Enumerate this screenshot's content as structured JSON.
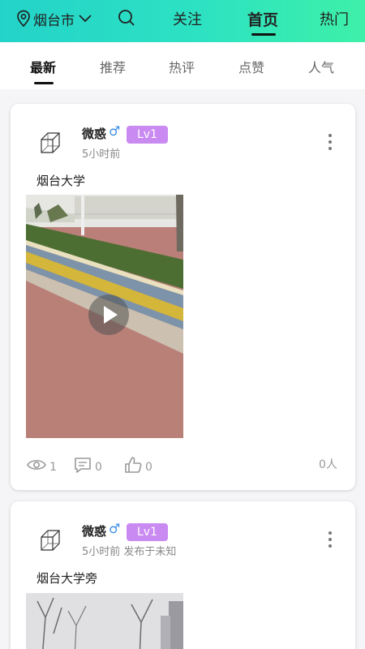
{
  "header": {
    "city": "烟台市",
    "tabs": [
      {
        "label": "关注"
      },
      {
        "label": "首页"
      },
      {
        "label": "热门"
      }
    ]
  },
  "subtabs": [
    "最新",
    "推荐",
    "热评",
    "点赞",
    "人气"
  ],
  "posts": [
    {
      "username": "微惑",
      "gender_symbol": "♂",
      "level": "Lv1",
      "time": "5小时前",
      "title": "烟台大学",
      "views": "1",
      "comments": "0",
      "likes": "0",
      "people": "0人"
    },
    {
      "username": "微惑",
      "gender_symbol": "♂",
      "level": "Lv1",
      "time": "5小时前 发布于未知",
      "title": "烟台大学旁"
    }
  ],
  "colors": {
    "header_gradient_start": "#23d3c9",
    "header_gradient_end": "#3ef0a8",
    "level_badge": "#c98af2",
    "male_symbol": "#3a8ee6"
  }
}
